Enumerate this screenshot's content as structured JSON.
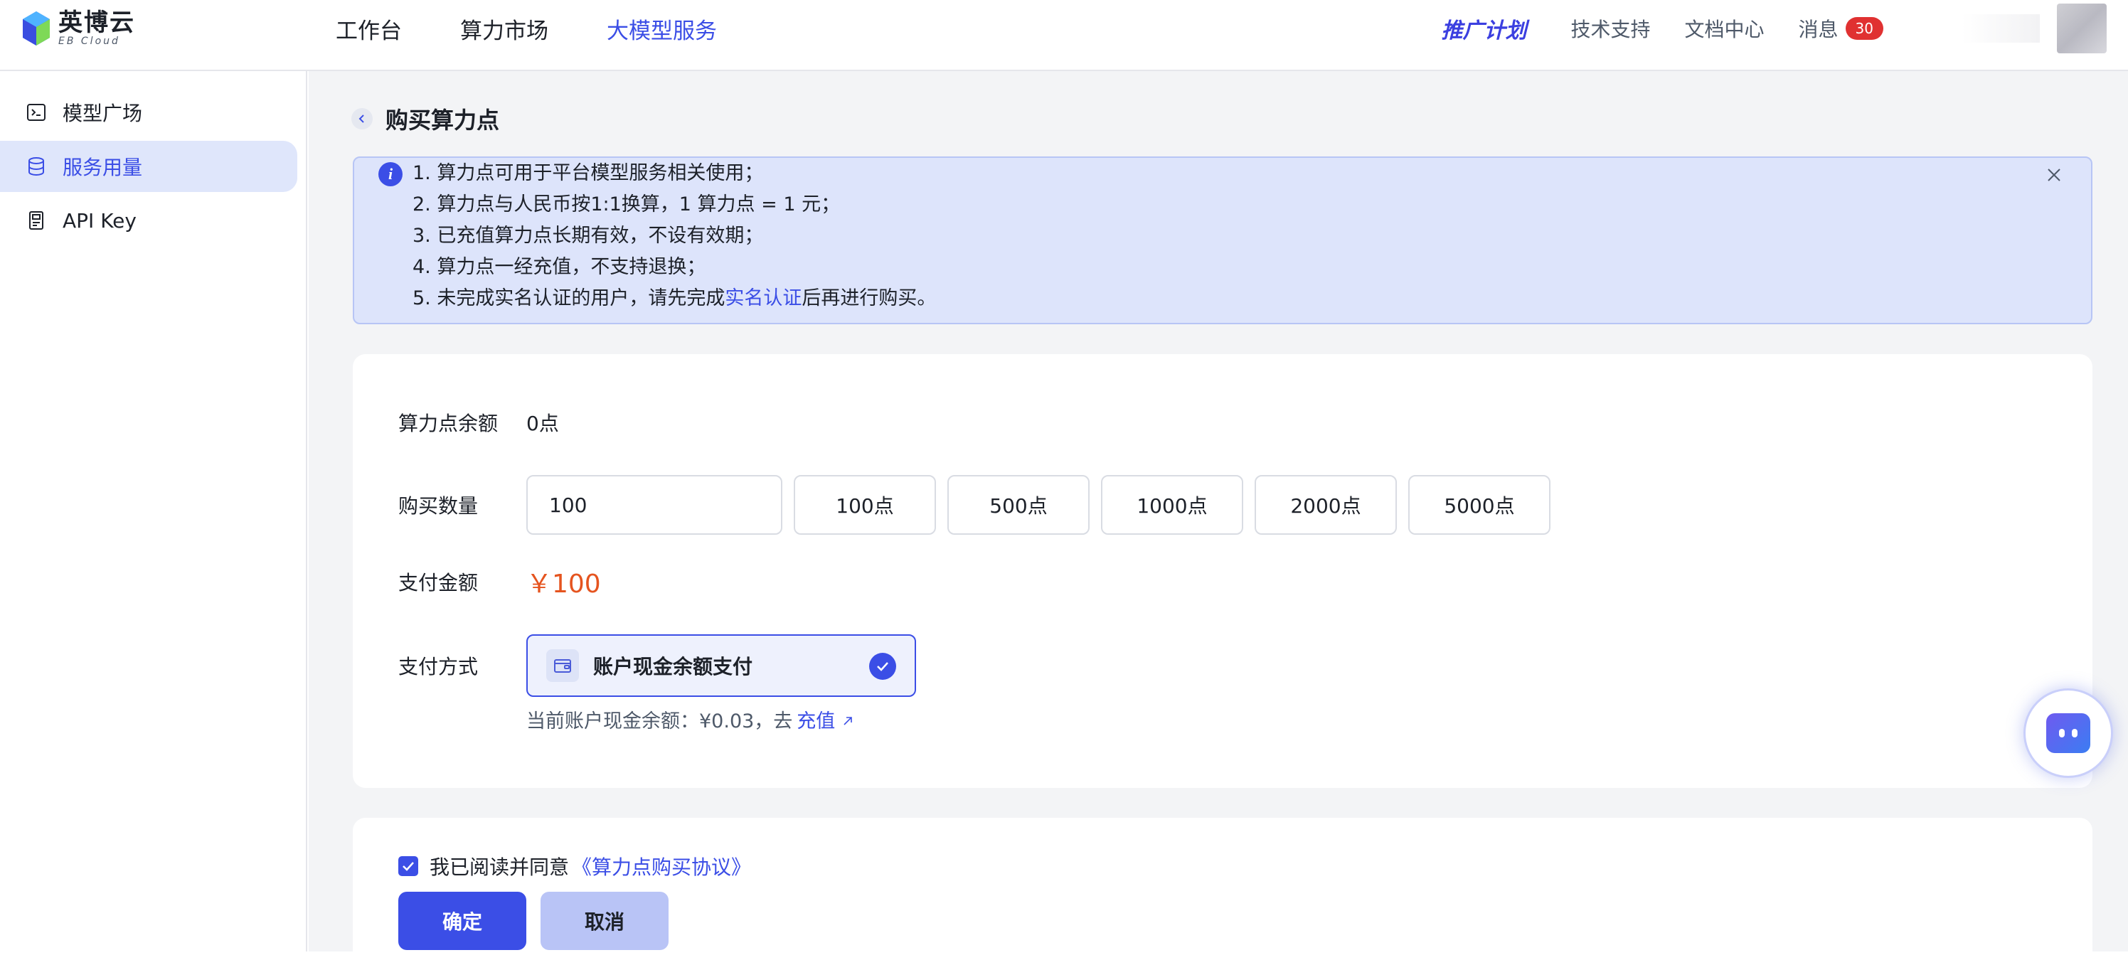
{
  "header": {
    "logo_cn": "英博云",
    "logo_en": "EB Cloud",
    "nav": [
      "工作台",
      "算力市场",
      "大模型服务"
    ],
    "nav_active_index": 2,
    "promo": "推广计划",
    "links": [
      "技术支持",
      "文档中心"
    ],
    "messages_label": "消息",
    "messages_count": "30"
  },
  "sidebar": {
    "items": [
      {
        "label": "模型广场",
        "icon": "terminal-icon"
      },
      {
        "label": "服务用量",
        "icon": "database-icon"
      },
      {
        "label": "API Key",
        "icon": "key-card-icon"
      }
    ],
    "active_index": 1
  },
  "page": {
    "title": "购买算力点"
  },
  "notice": {
    "line1": "1. 算力点可用于平台模型服务相关使用；",
    "line2": "2. 算力点与人民币按1:1换算，1 算力点 = 1 元；",
    "line3": "3. 已充值算力点长期有效，不设有效期；",
    "line4": "4. 算力点一经充值，不支持退换；",
    "line5_prefix": "5. 未完成实名认证的用户，请先完成",
    "line5_link": "实名认证",
    "line5_suffix": "后再进行购买。"
  },
  "form": {
    "balance_label": "算力点余额",
    "balance_value": "0点",
    "quantity_label": "购买数量",
    "quantity_value": "100",
    "quantity_options": [
      "100点",
      "500点",
      "1000点",
      "2000点",
      "5000点"
    ],
    "amount_label": "支付金额",
    "amount_value": "￥100",
    "method_label": "支付方式",
    "method_option": "账户现金余额支付",
    "balance_hint": "当前账户现金余额：¥0.03，去",
    "recharge_link": "充值"
  },
  "agreement": {
    "text": "我已阅读并同意",
    "link": "《算力点购买协议》",
    "checked": true
  },
  "buttons": {
    "confirm": "确定",
    "cancel": "取消"
  },
  "colors": {
    "accent": "#3b4ee6",
    "price": "#e5541f",
    "notice_bg": "#dde4fb",
    "badge": "#e03131"
  }
}
